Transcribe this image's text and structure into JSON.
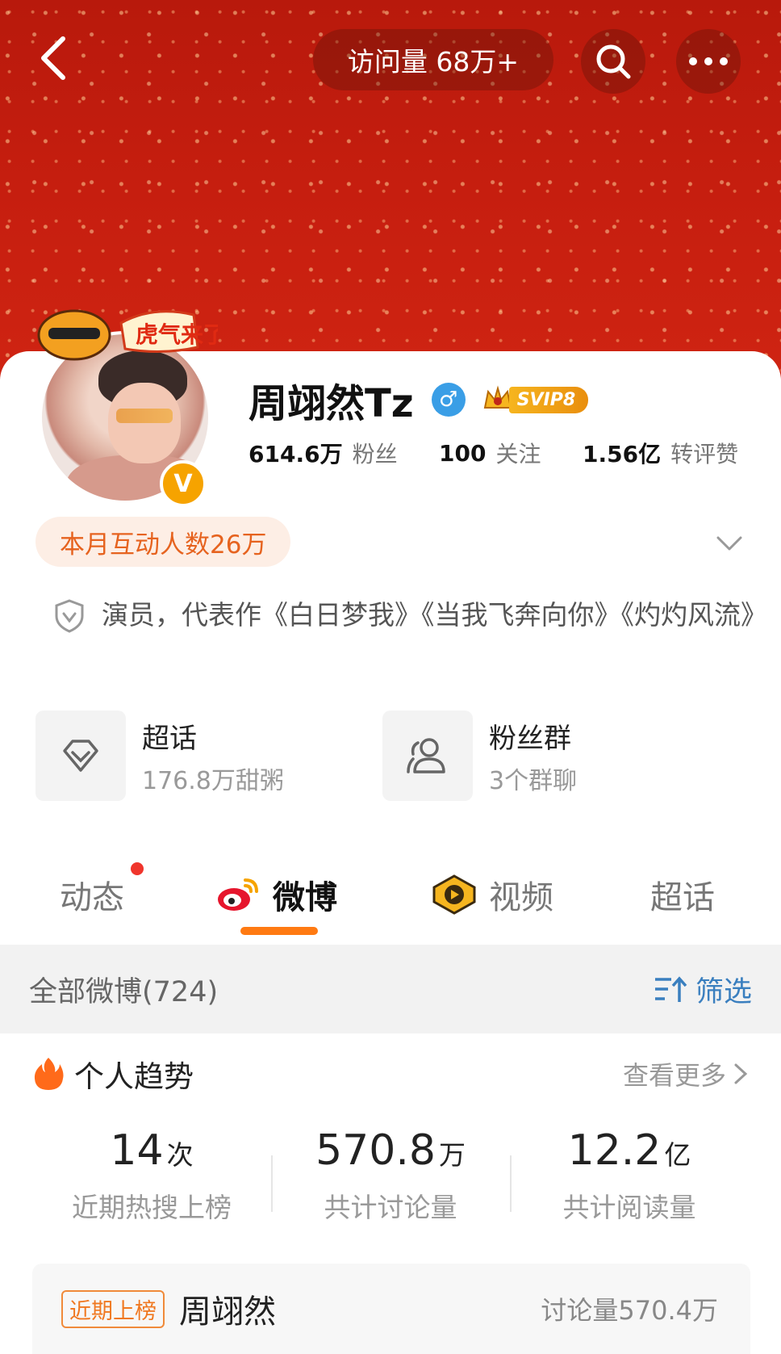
{
  "header": {
    "visits_label": "访问量 68万+"
  },
  "profile": {
    "avatar_sticker_text": "虎气来了",
    "name": "周翊然Tz",
    "gender_symbol": "♂",
    "vip_label": "SVIP8",
    "verified_badge": "V",
    "stats": {
      "followers_value": "614.6万",
      "followers_label": "粉丝",
      "following_value": "100",
      "following_label": "关注",
      "reposts_value": "1.56亿",
      "reposts_label": "转评赞"
    },
    "interact_pill": "本月互动人数26万",
    "verification_text": "演员，代表作《白日梦我》《当我飞奔向你》《灼灼风流》"
  },
  "quick_cards": [
    {
      "title": "超话",
      "subtitle": "176.8万甜粥"
    },
    {
      "title": "粉丝群",
      "subtitle": "3个群聊"
    }
  ],
  "tabs": {
    "dynamic": "动态",
    "weibo": "微博",
    "video": "视频",
    "super": "超话"
  },
  "filter_bar": {
    "all_weibo": "全部微博(724)",
    "filter": "筛选"
  },
  "trend": {
    "title": "个人趋势",
    "see_more": "查看更多",
    "stats": [
      {
        "value": "14",
        "unit": "次",
        "label": "近期热搜上榜"
      },
      {
        "value": "570.8",
        "unit": "万",
        "label": "共计讨论量"
      },
      {
        "value": "12.2",
        "unit": "亿",
        "label": "共计阅读量"
      }
    ]
  },
  "recent": {
    "tag": "近期上榜",
    "name": "周翊然",
    "count": "讨论量570.4万"
  },
  "colors": {
    "banner_red": "#c61e0f",
    "accent_orange": "#ff7a12",
    "link_blue": "#3a7fbf",
    "vip_gold": "#f6b51f"
  }
}
